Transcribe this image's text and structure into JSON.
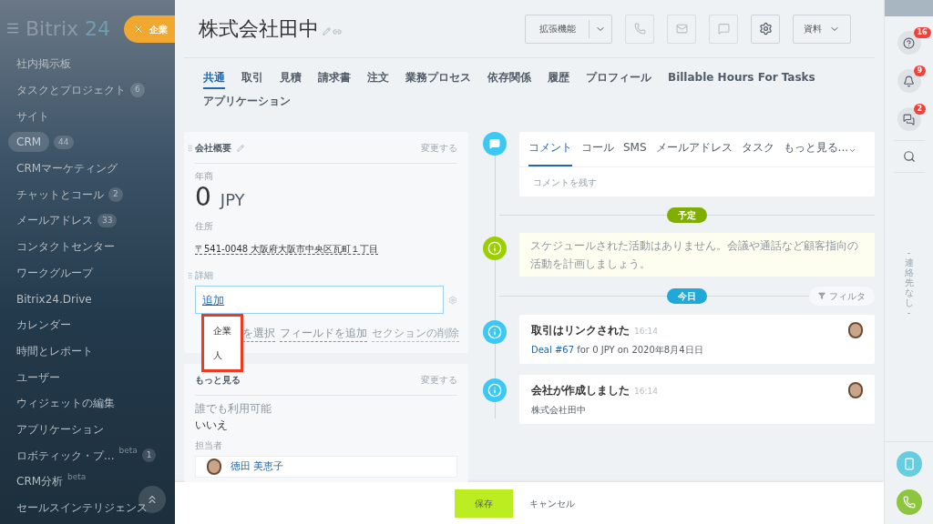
{
  "sidebar": {
    "logo": {
      "name": "Bitrix",
      "suffix": "24"
    },
    "close_tab": {
      "label": "企業"
    },
    "items": [
      {
        "label": "社内掲示板",
        "selected": false
      },
      {
        "label": "タスクとプロジェクト",
        "counter": "6",
        "selected": false
      },
      {
        "label": "サイト",
        "selected": false
      },
      {
        "label": "CRM",
        "counter": "44",
        "selected": true
      },
      {
        "label": "CRMマーケティング",
        "selected": false
      },
      {
        "label": "チャットとコール",
        "counter": "2",
        "selected": false
      },
      {
        "label": "メールアドレス",
        "counter": "33",
        "selected": false
      },
      {
        "label": "コンタクトセンター",
        "selected": false
      },
      {
        "label": "ワークグループ",
        "selected": false
      },
      {
        "label": "Bitrix24.Drive",
        "selected": false
      },
      {
        "label": "カレンダー",
        "selected": false
      },
      {
        "label": "時間とレポート",
        "selected": false
      },
      {
        "label": "ユーザー",
        "selected": false
      },
      {
        "label": "ウィジェットの編集",
        "selected": false
      },
      {
        "label": "アプリケーション",
        "selected": false
      },
      {
        "label": "ロボティック・プ...",
        "beta": "beta",
        "counter": "1",
        "selected": false
      },
      {
        "label": "CRM分析",
        "beta": "beta",
        "selected": false
      },
      {
        "label": "セールスインテリジェンス",
        "selected": false
      }
    ]
  },
  "header": {
    "title": "株式会社田中",
    "extensions_button": "拡張機能",
    "documents_button": "資料"
  },
  "tabs": [
    {
      "label": "共通",
      "selected": true
    },
    {
      "label": "取引",
      "selected": false
    },
    {
      "label": "見積",
      "selected": false
    },
    {
      "label": "請求書",
      "selected": false
    },
    {
      "label": "注文",
      "selected": false
    },
    {
      "label": "業務プロセス",
      "selected": false
    },
    {
      "label": "依存関係",
      "selected": false
    },
    {
      "label": "履歴",
      "selected": false
    },
    {
      "label": "プロフィール",
      "selected": false
    },
    {
      "label": "Billable Hours For Tasks",
      "selected": false
    },
    {
      "label": "アプリケーション",
      "selected": false
    }
  ],
  "company_section": {
    "title": "会社概要",
    "edit_link": "変更する",
    "revenue_label": "年商",
    "revenue_value": "0",
    "revenue_currency": "JPY",
    "address_label": "住所",
    "address_value": "〒541-0048 大阪府大阪市中央区瓦町１丁目",
    "details_label": "詳細",
    "add_field_value": "追加",
    "select_field_link": "を選択",
    "add_field_link": "フィールドを追加",
    "delete_section_link": "セクションの削除",
    "dropdown": {
      "items": [
        {
          "label": "企業"
        },
        {
          "label": "人"
        }
      ]
    }
  },
  "more_section": {
    "title": "もっと見る",
    "edit_link": "変更する",
    "available_label": "誰でも利用可能",
    "available_value": "いいえ",
    "assignee_label": "担当者",
    "assignee_name": "徳田 美恵子"
  },
  "activity": {
    "tabs": [
      {
        "label": "コメント",
        "selected": true
      },
      {
        "label": "コール",
        "selected": false
      },
      {
        "label": "SMS",
        "selected": false
      },
      {
        "label": "メールアドレス",
        "selected": false
      },
      {
        "label": "タスク",
        "selected": false
      },
      {
        "label": "もっと見る...",
        "selected": false
      }
    ],
    "placeholder": "コメントを残す"
  },
  "planned_label": "予定",
  "planned_empty": "スケジュールされた活動はありません。会議や通話など顧客指向の活動を計画しましょう。",
  "today_label": "今日",
  "filter_button": "フィルタ",
  "events": [
    {
      "title": "取引はリンクされた",
      "time": "16:14",
      "link": "Deal #67",
      "text": " for 0 JPY on 2020年8月4日日"
    },
    {
      "title": "会社が作成しました",
      "time": "16:14",
      "text": "株式会社田中"
    }
  ],
  "footer": {
    "save": "保存",
    "cancel": "キャンセル"
  },
  "right_rail": {
    "badges": [
      {
        "kind": "help",
        "count": "16"
      },
      {
        "kind": "bell",
        "count": "9"
      },
      {
        "kind": "chat",
        "count": "2"
      }
    ],
    "empty_text": "- 連絡先なし -"
  }
}
